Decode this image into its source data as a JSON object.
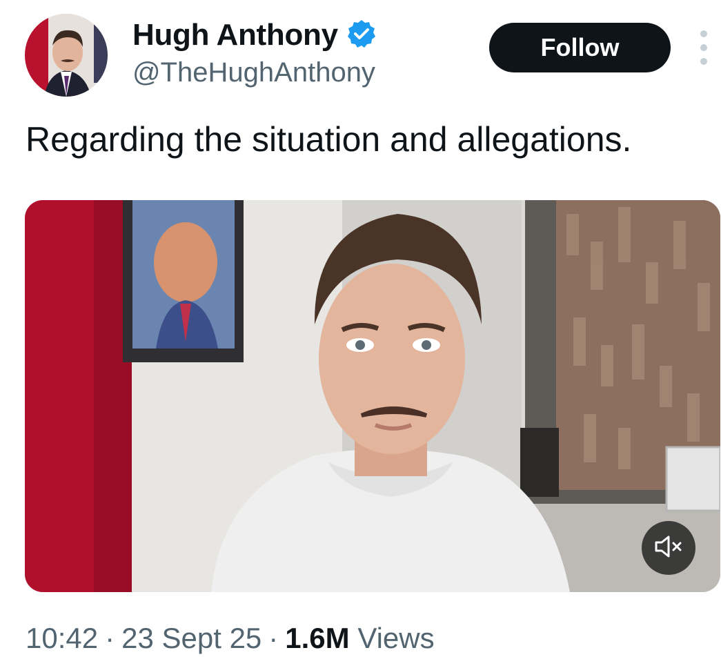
{
  "author": {
    "display_name": "Hugh Anthony",
    "handle": "@TheHughAnthony",
    "verified": true,
    "verified_badge_color": "#1d9bf0"
  },
  "actions": {
    "follow_label": "Follow",
    "more_icon": "more-vertical-icon"
  },
  "tweet": {
    "text": "Regarding the situation and allegations."
  },
  "media": {
    "type": "video",
    "muted": true,
    "mute_icon": "speaker-muted-icon"
  },
  "meta": {
    "time": "10:42",
    "date": "23 Sept 25",
    "separator": "·",
    "views_count": "1.6M",
    "views_label": "Views"
  },
  "colors": {
    "text_primary": "#0f1419",
    "text_secondary": "#536471",
    "follow_bg": "#0f1419"
  }
}
